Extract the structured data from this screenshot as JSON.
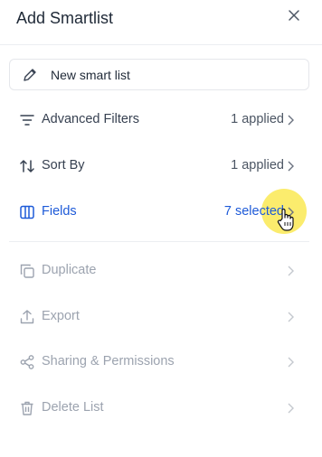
{
  "panel": {
    "title": "Add Smartlist"
  },
  "name_field": {
    "value": "New smart list"
  },
  "menu": {
    "advanced_filters": {
      "label": "Advanced Filters",
      "value": "1 applied"
    },
    "sort_by": {
      "label": "Sort By",
      "value": "1 applied"
    },
    "fields": {
      "label": "Fields",
      "value": "7 selected"
    },
    "duplicate": {
      "label": "Duplicate"
    },
    "export": {
      "label": "Export"
    },
    "sharing": {
      "label": "Sharing & Permissions"
    },
    "delete_list": {
      "label": "Delete List"
    }
  },
  "colors": {
    "accent": "#1d5ad8",
    "disabled": "#9ca3af",
    "highlight": "#f9e63c"
  }
}
